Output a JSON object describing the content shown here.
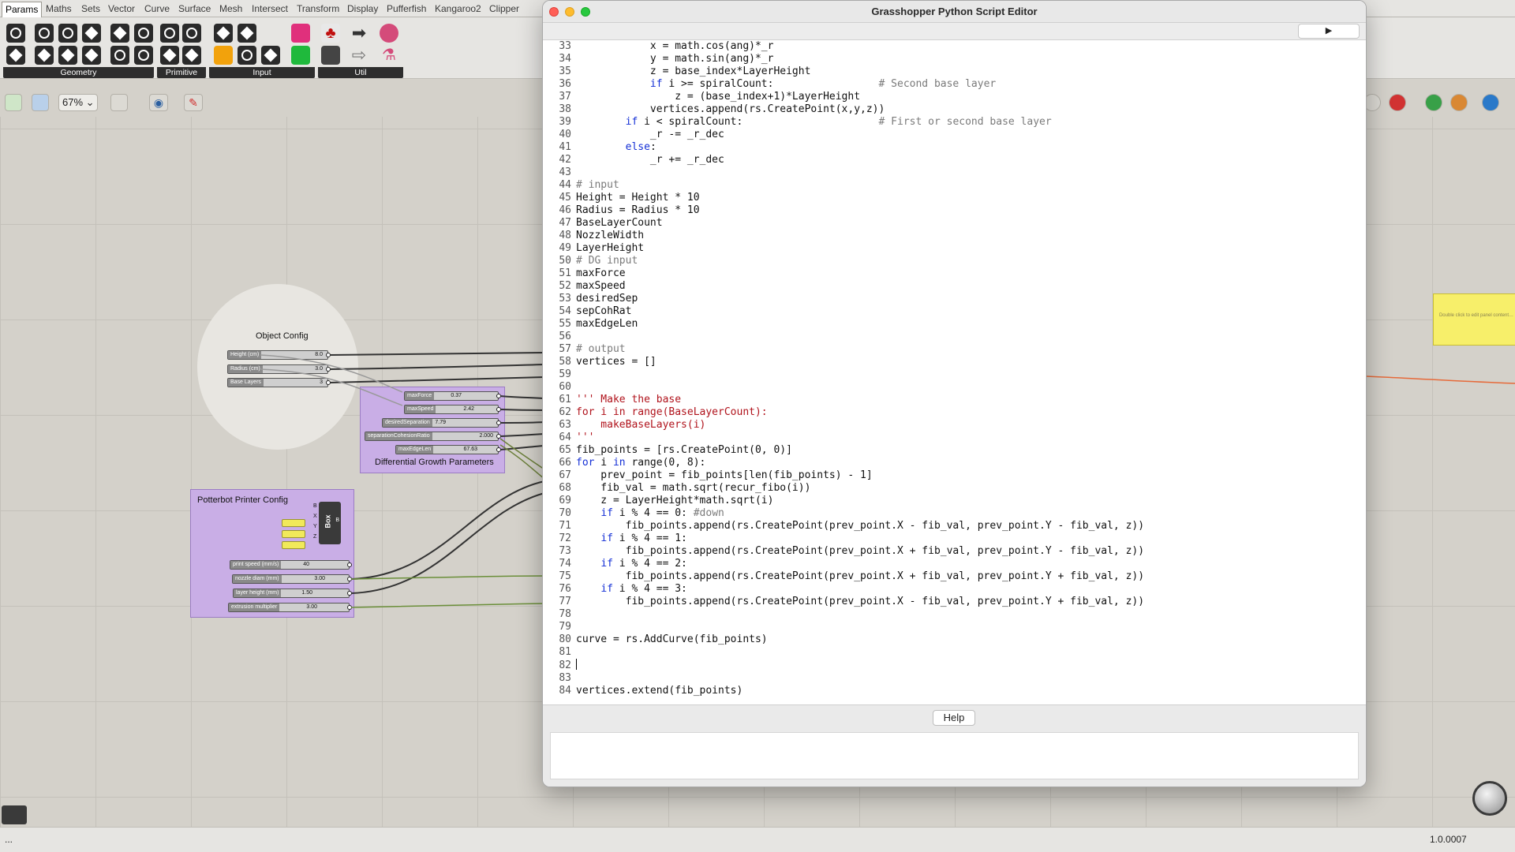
{
  "gh": {
    "tabs": [
      {
        "label": "Params",
        "active": true
      },
      {
        "label": "Maths"
      },
      {
        "label": "Sets"
      },
      {
        "label": "Vector"
      },
      {
        "label": "Curve"
      },
      {
        "label": "Surface"
      },
      {
        "label": "Mesh"
      },
      {
        "label": "Intersect"
      },
      {
        "label": "Transform"
      },
      {
        "label": "Display"
      },
      {
        "label": "Pufferfish"
      },
      {
        "label": "Kangaroo2"
      },
      {
        "label": "Clipper"
      }
    ],
    "ribbon_groups": [
      "Geometry",
      "Primitive",
      "Input",
      "Util"
    ],
    "zoom": "67%",
    "status_left": "...",
    "version": "1.0.0007",
    "object_config": {
      "title": "Object Config",
      "sliders": [
        {
          "label": "Height (cm)",
          "value": "8.0"
        },
        {
          "label": "Radius (cm)",
          "value": "3.0"
        },
        {
          "label": "Base Layers",
          "value": "3"
        }
      ]
    },
    "diff_growth": {
      "title": "Differential Growth Parameters",
      "sliders": [
        {
          "label": "maxForce",
          "value": "0.37"
        },
        {
          "label": "maxSpeed",
          "value": "2.42"
        },
        {
          "label": "desiredSeparation",
          "value": "7.79"
        },
        {
          "label": "separationCohesionRatio",
          "value": "2.000"
        },
        {
          "label": "maxEdgeLen",
          "value": "67.63"
        }
      ]
    },
    "potterbot": {
      "title": "Potterbot Printer Config",
      "box_label": "Box",
      "box_inputs": [
        "B",
        "X",
        "Y",
        "Z"
      ],
      "box_output": "B",
      "sliders": [
        {
          "label": "print speed (mm/s)",
          "value": "40"
        },
        {
          "label": "nozzle diam (mm)",
          "value": "3.00"
        },
        {
          "label": "layer height (mm)",
          "value": "1.50"
        },
        {
          "label": "extrusion multiplier",
          "value": "3.00"
        }
      ]
    },
    "panel_text": "Double click to edit panel content…"
  },
  "editor": {
    "title": "Grasshopper Python Script Editor",
    "run_label": "▶",
    "help_label": "Help",
    "code": [
      {
        "n": "33",
        "t": [
          [
            "",
            "            x = math.cos(ang)*_r"
          ]
        ]
      },
      {
        "n": "34",
        "t": [
          [
            "",
            "            y = math.sin(ang)*_r"
          ]
        ]
      },
      {
        "n": "35",
        "t": [
          [
            "",
            "            z = base_index*LayerHeight"
          ]
        ]
      },
      {
        "n": "36",
        "t": [
          [
            "",
            "            "
          ],
          [
            "kw",
            "if"
          ],
          [
            "",
            " i >= spiralCount:                 "
          ],
          [
            "cm",
            "# Second base layer"
          ]
        ]
      },
      {
        "n": "37",
        "t": [
          [
            "",
            "                z = (base_index+1)*LayerHeight"
          ]
        ]
      },
      {
        "n": "38",
        "t": [
          [
            "",
            "            vertices.append(rs.CreatePoint(x,y,z))"
          ]
        ]
      },
      {
        "n": "39",
        "t": [
          [
            "",
            "        "
          ],
          [
            "kw",
            "if"
          ],
          [
            "",
            " i < spiralCount:                      "
          ],
          [
            "cm",
            "# First or second base layer"
          ]
        ]
      },
      {
        "n": "40",
        "t": [
          [
            "",
            "            _r -= _r_dec"
          ]
        ]
      },
      {
        "n": "41",
        "t": [
          [
            "",
            "        "
          ],
          [
            "kw",
            "else"
          ],
          [
            "",
            ":"
          ]
        ]
      },
      {
        "n": "42",
        "t": [
          [
            "",
            "            _r += _r_dec"
          ]
        ]
      },
      {
        "n": "43",
        "t": [
          [
            "",
            ""
          ]
        ]
      },
      {
        "n": "44",
        "t": [
          [
            "cm",
            "# input"
          ]
        ]
      },
      {
        "n": "45",
        "t": [
          [
            "",
            "Height = Height * 10"
          ]
        ]
      },
      {
        "n": "46",
        "t": [
          [
            "",
            "Radius = Radius * 10"
          ]
        ]
      },
      {
        "n": "47",
        "t": [
          [
            "",
            "BaseLayerCount"
          ]
        ]
      },
      {
        "n": "48",
        "t": [
          [
            "",
            "NozzleWidth"
          ]
        ]
      },
      {
        "n": "49",
        "t": [
          [
            "",
            "LayerHeight"
          ]
        ]
      },
      {
        "n": "50",
        "t": [
          [
            "cm",
            "# DG input"
          ]
        ]
      },
      {
        "n": "51",
        "t": [
          [
            "",
            "maxForce"
          ]
        ]
      },
      {
        "n": "52",
        "t": [
          [
            "",
            "maxSpeed"
          ]
        ]
      },
      {
        "n": "53",
        "t": [
          [
            "",
            "desiredSep"
          ]
        ]
      },
      {
        "n": "54",
        "t": [
          [
            "",
            "sepCohRat"
          ]
        ]
      },
      {
        "n": "55",
        "t": [
          [
            "",
            "maxEdgeLen"
          ]
        ]
      },
      {
        "n": "56",
        "t": [
          [
            "",
            ""
          ]
        ]
      },
      {
        "n": "57",
        "t": [
          [
            "cm",
            "# output"
          ]
        ]
      },
      {
        "n": "58",
        "t": [
          [
            "",
            "vertices = []"
          ]
        ]
      },
      {
        "n": "59",
        "t": [
          [
            "",
            ""
          ]
        ]
      },
      {
        "n": "60",
        "t": [
          [
            "",
            ""
          ]
        ]
      },
      {
        "n": "61",
        "t": [
          [
            "str",
            "''' Make the base"
          ]
        ]
      },
      {
        "n": "62",
        "t": [
          [
            "str",
            "for i in range(BaseLayerCount):"
          ]
        ]
      },
      {
        "n": "63",
        "t": [
          [
            "str",
            "    makeBaseLayers(i)"
          ]
        ]
      },
      {
        "n": "64",
        "t": [
          [
            "str",
            "'''"
          ]
        ]
      },
      {
        "n": "65",
        "t": [
          [
            "",
            "fib_points = [rs.CreatePoint(0, 0)]"
          ]
        ]
      },
      {
        "n": "66",
        "t": [
          [
            "kw",
            "for"
          ],
          [
            "",
            " i "
          ],
          [
            "kw",
            "in"
          ],
          [
            "",
            " range(0, 8):"
          ]
        ]
      },
      {
        "n": "67",
        "t": [
          [
            "",
            "    prev_point = fib_points[len(fib_points) - 1]"
          ]
        ]
      },
      {
        "n": "68",
        "t": [
          [
            "",
            "    fib_val = math.sqrt(recur_fibo(i))"
          ]
        ]
      },
      {
        "n": "69",
        "t": [
          [
            "",
            "    z = LayerHeight*math.sqrt(i)"
          ]
        ]
      },
      {
        "n": "70",
        "t": [
          [
            "",
            "    "
          ],
          [
            "kw",
            "if"
          ],
          [
            "",
            " i % 4 == 0: "
          ],
          [
            "cm",
            "#down"
          ]
        ]
      },
      {
        "n": "71",
        "t": [
          [
            "",
            "        fib_points.append(rs.CreatePoint(prev_point.X - fib_val, prev_point.Y - fib_val, z))"
          ]
        ]
      },
      {
        "n": "72",
        "t": [
          [
            "",
            "    "
          ],
          [
            "kw",
            "if"
          ],
          [
            "",
            " i % 4 == 1:"
          ]
        ]
      },
      {
        "n": "73",
        "t": [
          [
            "",
            "        fib_points.append(rs.CreatePoint(prev_point.X + fib_val, prev_point.Y - fib_val, z))"
          ]
        ]
      },
      {
        "n": "74",
        "t": [
          [
            "",
            "    "
          ],
          [
            "kw",
            "if"
          ],
          [
            "",
            " i % 4 == 2:"
          ]
        ]
      },
      {
        "n": "75",
        "t": [
          [
            "",
            "        fib_points.append(rs.CreatePoint(prev_point.X + fib_val, prev_point.Y + fib_val, z))"
          ]
        ]
      },
      {
        "n": "76",
        "t": [
          [
            "",
            "    "
          ],
          [
            "kw",
            "if"
          ],
          [
            "",
            " i % 4 == 3:"
          ]
        ]
      },
      {
        "n": "77",
        "t": [
          [
            "",
            "        fib_points.append(rs.CreatePoint(prev_point.X - fib_val, prev_point.Y + fib_val, z))"
          ]
        ]
      },
      {
        "n": "78",
        "t": [
          [
            "",
            ""
          ]
        ]
      },
      {
        "n": "79",
        "t": [
          [
            "",
            ""
          ]
        ]
      },
      {
        "n": "80",
        "t": [
          [
            "",
            "curve = rs.AddCurve(fib_points)"
          ]
        ]
      },
      {
        "n": "81",
        "t": [
          [
            "",
            ""
          ]
        ]
      },
      {
        "n": "82",
        "t": [
          [
            "caret",
            ""
          ]
        ]
      },
      {
        "n": "83",
        "t": [
          [
            "",
            ""
          ]
        ]
      },
      {
        "n": "84",
        "t": [
          [
            "",
            "vertices.extend(fib_points)"
          ]
        ]
      }
    ]
  },
  "colors": {
    "cluster_purple": "#c9aee6",
    "panel_yellow": "#f7ef6a",
    "keyword_blue": "#1530d6",
    "string_red": "#b0121b",
    "comment_grey": "#7a7a7a"
  }
}
